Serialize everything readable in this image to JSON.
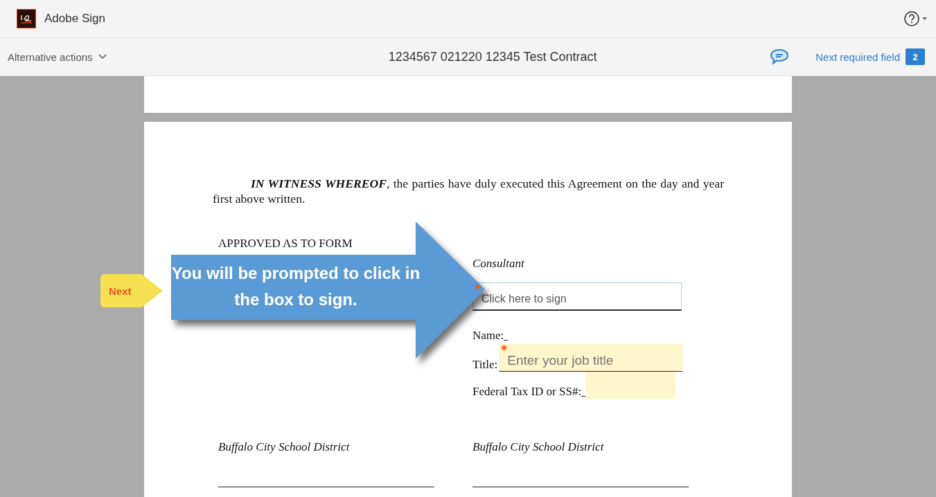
{
  "header": {
    "app_name": "Adobe Sign"
  },
  "toolbar": {
    "alternative_actions": "Alternative actions",
    "document_title": "1234567 021220 12345 Test Contract",
    "next_required_field": {
      "label": "Next required field",
      "count": "2"
    }
  },
  "document": {
    "paragraph": "**IN WITNESS WHEREOF**, the parties have duly executed this Agreement on the day and year first above written.",
    "left_column": {
      "heading": "APPROVED AS TO FORM",
      "signer": "Buffalo City School District"
    },
    "right_column": {
      "heading": "Consultant",
      "sign_field": {
        "placeholder": "Click here to sign",
        "required": true
      },
      "name_label": "Name:",
      "title_label": "Title:",
      "title_field": {
        "placeholder": "Enter your job title",
        "required": true
      },
      "tax_label": "Federal Tax ID or SS#:",
      "tax_field": {
        "required": false
      },
      "signer": "Buffalo City School District"
    }
  },
  "next_tag": "Next",
  "callout": "You will be prompted to click in the box to sign."
}
